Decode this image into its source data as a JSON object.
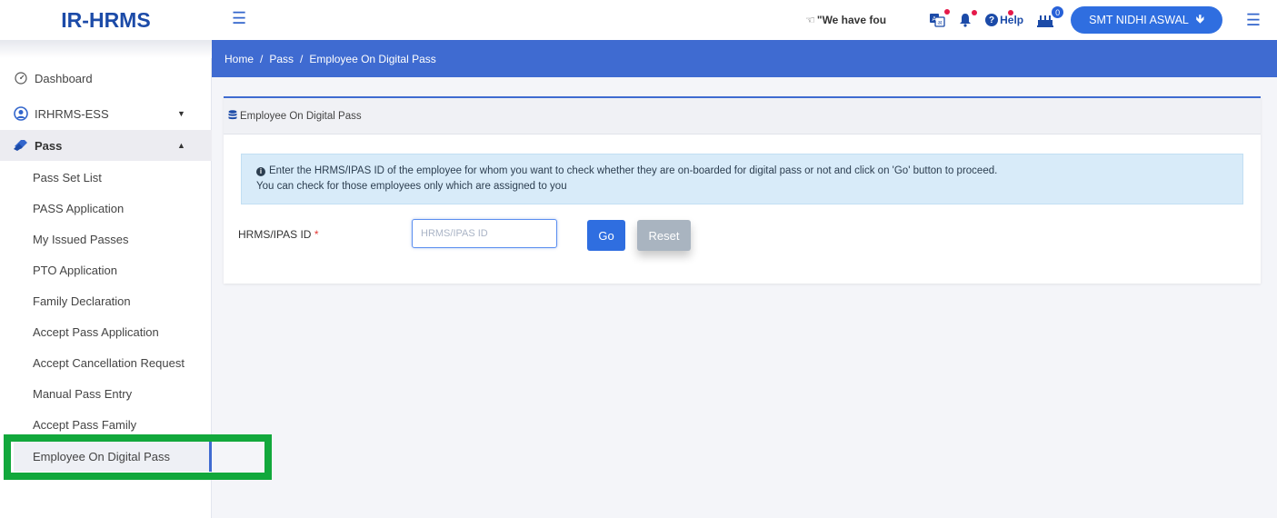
{
  "app": {
    "title": "IR-HRMS"
  },
  "topbar": {
    "ticker_text": "\"We have fou",
    "help_label": "Help",
    "cake_count": "0",
    "user_name": "SMT NIDHI ASWAL",
    "user_arrow": "🡻"
  },
  "sidebar": {
    "dashboard": "Dashboard",
    "ess": "IRHRMS-ESS",
    "pass_group": "Pass",
    "items": [
      "Pass Set List",
      "PASS Application",
      "My Issued Passes",
      "PTO Application",
      "Family Declaration",
      "Accept Pass Application",
      "Accept Cancellation Request",
      "Manual Pass Entry",
      "Accept Pass Family",
      "Employee On Digital Pass"
    ]
  },
  "breadcrumb": [
    "Home",
    "Pass",
    "Employee On Digital Pass"
  ],
  "card": {
    "title": "Employee On Digital Pass",
    "info_line1": "Enter the HRMS/IPAS ID of the employee for whom you want to check whether they are on-boarded for digital pass or not and click on 'Go' button to proceed.",
    "info_line2": "You can check for those employees only which are assigned to you",
    "field_label": "HRMS/IPAS ID",
    "required_mark": "*",
    "input_placeholder": "HRMS/IPAS ID",
    "input_value": "",
    "go_label": "Go",
    "reset_label": "Reset"
  },
  "colors": {
    "brand": "#1c4ba8",
    "accent": "#3f6bd1",
    "button": "#2f6ee0",
    "highlight": "#12a83c",
    "notification_dot": "#e5194a"
  },
  "icons": {
    "menu": "hamburger-icon",
    "ticker": "thumbs-up-icon",
    "translate": "translate-icon",
    "bell": "bell-icon",
    "help": "question-icon",
    "cake": "cake-icon",
    "dashboard": "dashboard-icon",
    "ess": "user-circle-icon",
    "pass": "ticket-icon",
    "card_header": "database-icon",
    "info": "info-icon"
  }
}
